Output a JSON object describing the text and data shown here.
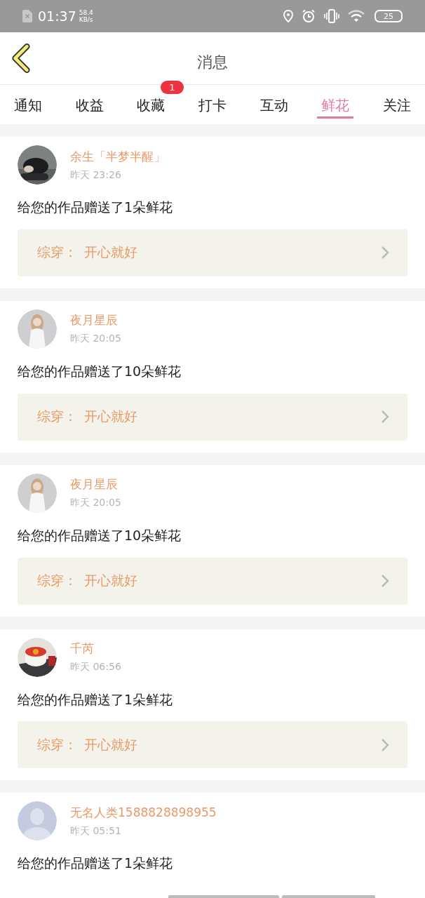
{
  "status_bar": {
    "time": "01:37",
    "speed": "58.4",
    "speed_unit": "KB/s",
    "battery": "25"
  },
  "header": {
    "title": "消息"
  },
  "tabs": [
    {
      "label": "通知",
      "selected": false
    },
    {
      "label": "收益",
      "selected": false
    },
    {
      "label": "收藏",
      "selected": false,
      "badge": "1"
    },
    {
      "label": "打卡",
      "selected": false
    },
    {
      "label": "互动",
      "selected": false
    },
    {
      "label": "鲜花",
      "selected": true
    },
    {
      "label": "关注",
      "selected": false
    }
  ],
  "messages": [
    {
      "name": "余生「半梦半醒」",
      "time": "昨天 23:26",
      "text": "给您的作品赠送了1朵鲜花",
      "book": {
        "category": "综穿：",
        "title": "开心就好"
      }
    },
    {
      "name": "夜月星辰",
      "time": "昨天 20:05",
      "text": "给您的作品赠送了10朵鲜花",
      "book": {
        "category": "综穿：",
        "title": "开心就好"
      }
    },
    {
      "name": "夜月星辰",
      "time": "昨天 20:05",
      "text": "给您的作品赠送了10朵鲜花",
      "book": {
        "category": "综穿：",
        "title": "开心就好"
      }
    },
    {
      "name": "千芮",
      "time": "昨天 06:56",
      "text": "给您的作品赠送了1朵鲜花",
      "book": {
        "category": "综穿：",
        "title": "开心就好"
      }
    },
    {
      "avatar": {
        "kind": "default"
      },
      "name": "无名人类1588828898955",
      "time": "昨天 05:51",
      "text": "给您的作品赠送了1朵鲜花"
    }
  ]
}
